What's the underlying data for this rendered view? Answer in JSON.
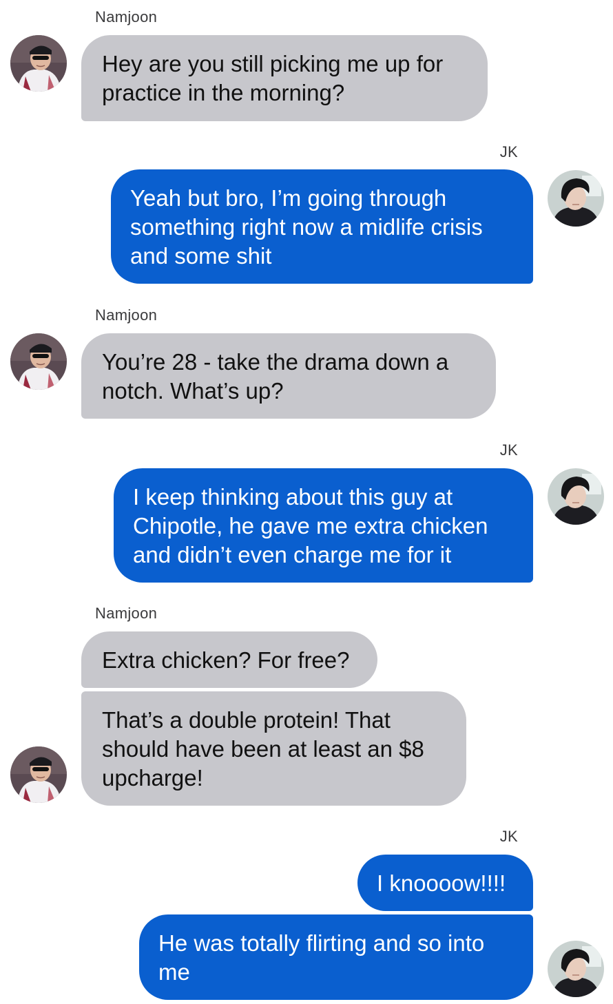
{
  "conversation": {
    "participants": {
      "left": "Namjoon",
      "right": "JK"
    },
    "groups": [
      {
        "sender": "Namjoon",
        "side": "left",
        "messages": [
          "Hey are you still picking me up for\npractice in the morning?"
        ]
      },
      {
        "sender": "JK",
        "side": "right",
        "messages": [
          "Yeah but bro, I’m going through\nsomething right now a midlife crisis\nand some shit"
        ]
      },
      {
        "sender": "Namjoon",
        "side": "left",
        "messages": [
          "You’re 28 - take the drama down a\nnotch. What’s up?"
        ]
      },
      {
        "sender": "JK",
        "side": "right",
        "messages": [
          "I keep thinking about this guy at\nChipotle, he gave me extra chicken\nand didn’t even charge me for it"
        ]
      },
      {
        "sender": "Namjoon",
        "side": "left",
        "messages": [
          "Extra chicken? For free?",
          "That’s a double protein! That\nshould have been at least an $8\nupcharge!"
        ]
      },
      {
        "sender": "JK",
        "side": "right",
        "messages": [
          "I knoooow!!!!",
          "He was totally flirting and so into\nme"
        ]
      }
    ]
  },
  "colors": {
    "incoming_bubble": "#c7c7cc",
    "outgoing_bubble": "#0a5fcf",
    "background": "#ffffff"
  },
  "icons": {
    "left_avatar": "namjoon-avatar-photo",
    "right_avatar": "jk-avatar-photo"
  }
}
